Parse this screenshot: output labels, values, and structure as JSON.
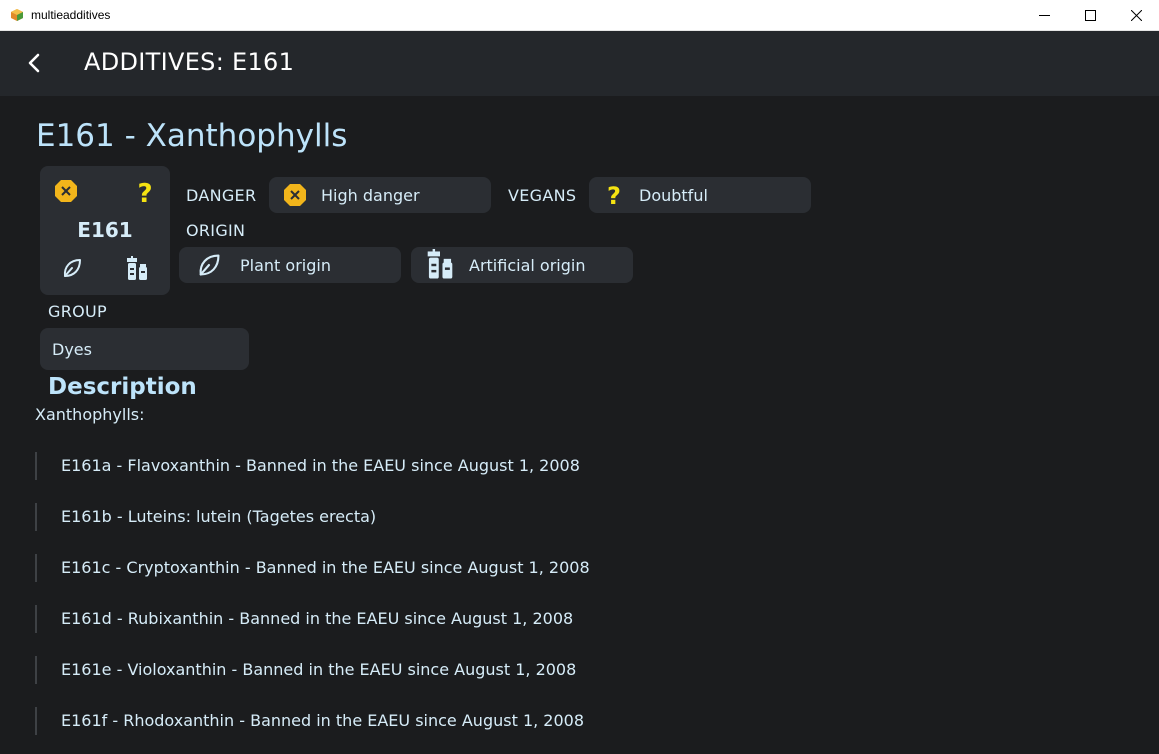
{
  "window": {
    "title": "multieadditives"
  },
  "header": {
    "title": "ADDITIVES: E161"
  },
  "page": {
    "title": "E161 - Xanthophylls"
  },
  "badge": {
    "code": "E161"
  },
  "danger": {
    "label": "DANGER",
    "value": "High danger"
  },
  "vegans": {
    "label": "VEGANS",
    "value": "Doubtful"
  },
  "origin": {
    "label": "ORIGIN",
    "items": [
      "Plant origin",
      "Artificial origin"
    ]
  },
  "group": {
    "label": "GROUP",
    "value": "Dyes"
  },
  "description": {
    "title": "Description",
    "intro": "Xanthophylls:",
    "items": [
      "E161a - Flavoxanthin - Banned in the EAEU since August 1, 2008",
      "E161b - Luteins: lutein (Tagetes erecta)",
      "E161c - Cryptoxanthin - Banned in the EAEU since August 1, 2008",
      "E161d - Rubixanthin - Banned in the EAEU since August 1, 2008",
      "E161e - Violoxanthin - Banned in the EAEU since August 1, 2008",
      "E161f - Rhodoxanthin - Banned in the EAEU since August 1, 2008"
    ]
  },
  "colors": {
    "background": "#1b1c1e",
    "appbar": "#24272b",
    "card": "#2b2e33",
    "title": "#bde3fa",
    "danger_icon": "#f2b51b",
    "vegan_icon": "#f5e312"
  },
  "icons": [
    "app-icon",
    "minimize-icon",
    "maximize-icon",
    "close-icon",
    "back-arrow-icon",
    "danger-octagon-icon",
    "question-mark-icon",
    "leaf-icon",
    "artificial-vials-icon"
  ]
}
